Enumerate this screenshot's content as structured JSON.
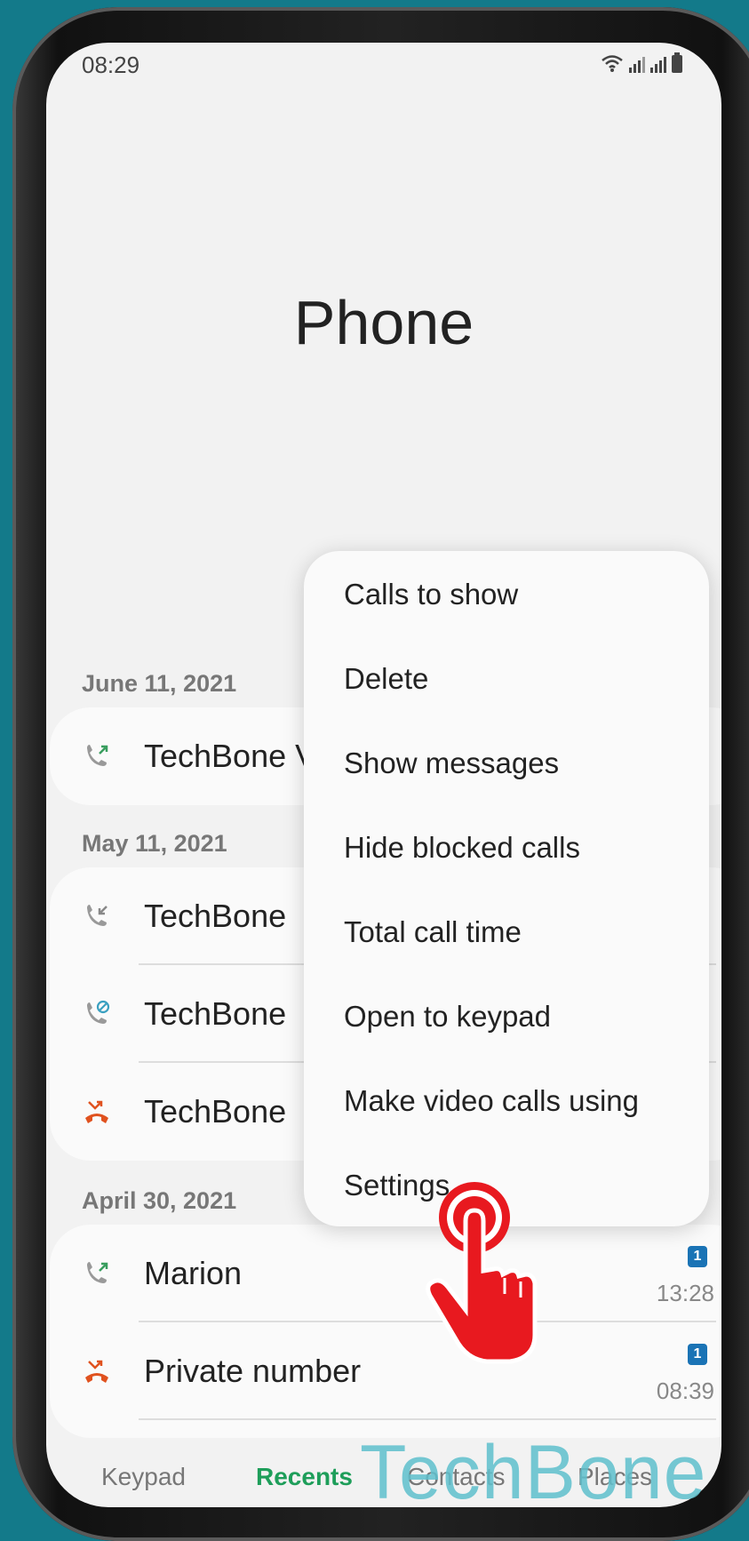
{
  "status_bar": {
    "time": "08:29"
  },
  "app": {
    "title": "Phone"
  },
  "sections": [
    {
      "date": "June 11, 2021",
      "rows": [
        {
          "name": "TechBone V",
          "type": "outgoing",
          "color": "#3a9e5f"
        }
      ]
    },
    {
      "date": "May 11, 2021",
      "rows": [
        {
          "name": "TechBone",
          "type": "incoming",
          "color": "#888888"
        },
        {
          "name": "TechBone",
          "type": "blocked",
          "color": "#3aa0c0"
        },
        {
          "name": "TechBone",
          "type": "missed",
          "color": "#e0521f"
        }
      ]
    },
    {
      "date": "April 30, 2021",
      "rows": [
        {
          "name": "Marion",
          "type": "outgoing",
          "sim": "1",
          "time": "13:28",
          "color": "#3a9e5f"
        },
        {
          "name": "Private number",
          "type": "missed",
          "sim": "1",
          "time": "08:39",
          "color": "#e0521f"
        }
      ]
    }
  ],
  "menu": {
    "items": [
      "Calls to show",
      "Delete",
      "Show messages",
      "Hide blocked calls",
      "Total call time",
      "Open to keypad",
      "Make video calls using",
      "Settings"
    ]
  },
  "bottom_nav": {
    "items": [
      "Keypad",
      "Recents",
      "Contacts",
      "Places"
    ],
    "active": "Recents"
  },
  "watermark": "TechBone",
  "colors": {
    "accent": "#1e9e5a",
    "background": "#137a8a",
    "tap_indicator": "#e8191f"
  }
}
